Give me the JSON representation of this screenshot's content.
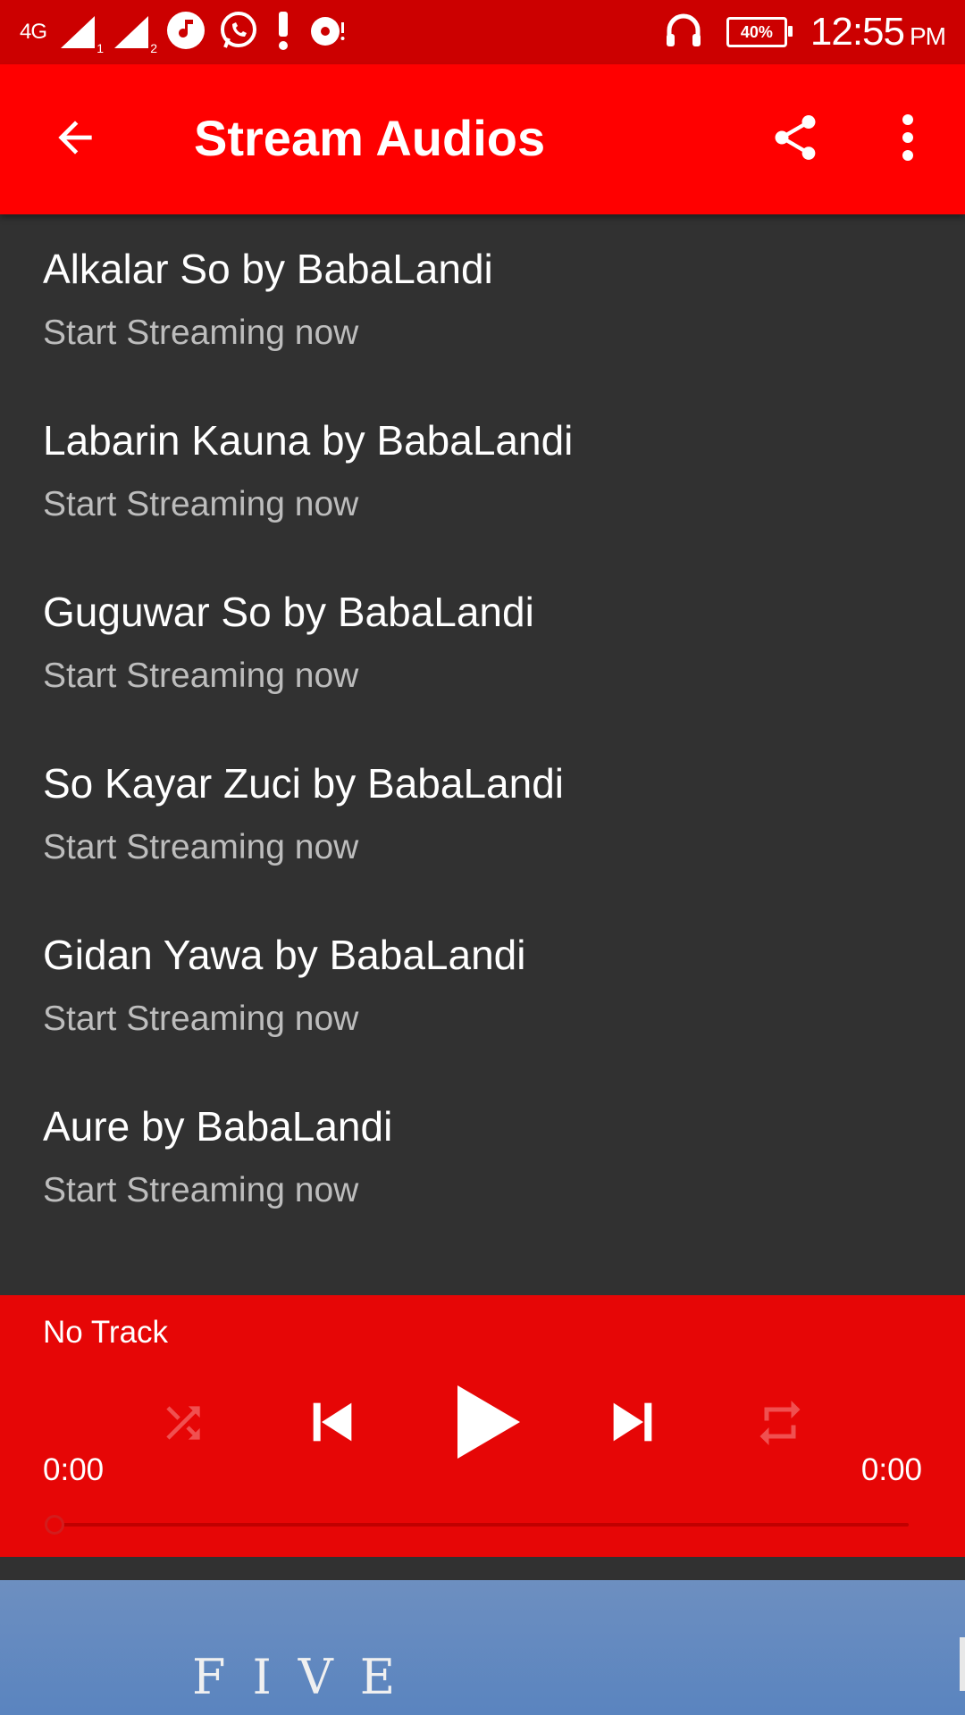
{
  "status_bar": {
    "network_type": "4G",
    "sim1_label": "1",
    "sim2_label": "2",
    "battery": "40%",
    "time": "12:55",
    "ampm": "PM"
  },
  "app_bar": {
    "title": "Stream Audios",
    "icons": [
      "arrow-back-icon",
      "share-icon",
      "more-vert-icon"
    ]
  },
  "tracks": [
    {
      "title": "Alkalar So by BabaLandi",
      "subtitle": "Start Streaming now"
    },
    {
      "title": "Labarin Kauna by BabaLandi",
      "subtitle": "Start Streaming now"
    },
    {
      "title": "Guguwar So by BabaLandi",
      "subtitle": "Start Streaming now"
    },
    {
      "title": "So Kayar Zuci by BabaLandi",
      "subtitle": "Start Streaming now"
    },
    {
      "title": "Gidan Yawa by BabaLandi",
      "subtitle": "Start Streaming now"
    },
    {
      "title": "Aure by BabaLandi",
      "subtitle": "Start Streaming now"
    }
  ],
  "player": {
    "track_name": "No Track",
    "elapsed": "0:00",
    "duration": "0:00",
    "progress": 0,
    "icons": [
      "shuffle-icon",
      "skip-previous-icon",
      "play-icon",
      "skip-next-icon",
      "repeat-icon"
    ]
  },
  "ad": {
    "text": "FIVE"
  },
  "colors": {
    "status_bar": "#cc0000",
    "app_bar": "#ff0000",
    "player": "#e60606",
    "list_background": "#313131",
    "subtitle": "#bdbdbd",
    "disabled_icon": "#f05050"
  }
}
